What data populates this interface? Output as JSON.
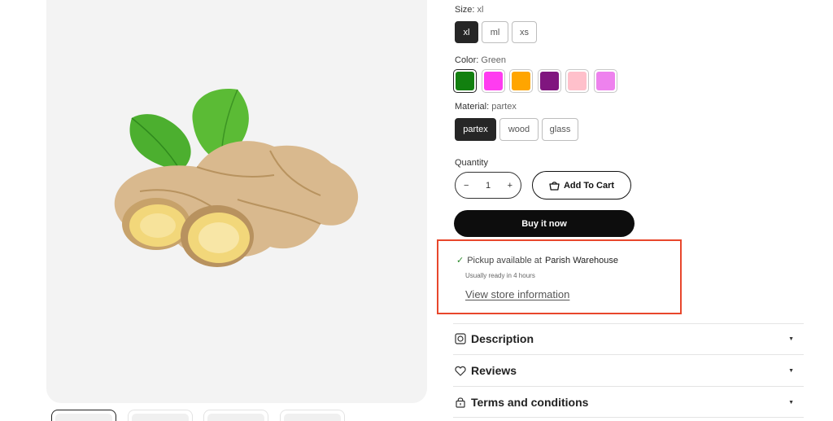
{
  "size": {
    "label": "Size:",
    "value": "xl",
    "options": [
      "xl",
      "ml",
      "xs"
    ],
    "selected": "xl"
  },
  "color": {
    "label": "Color:",
    "value": "Green",
    "selected_index": 0,
    "swatches": [
      "#12800f",
      "#ff3cf0",
      "#ffa500",
      "#80167f",
      "#ffc0cb",
      "#ee82ee"
    ]
  },
  "material": {
    "label": "Material:",
    "value": "partex",
    "options": [
      "partex",
      "wood",
      "glass"
    ],
    "selected": "partex"
  },
  "quantity": {
    "label": "Quantity",
    "minus": "−",
    "value": "1",
    "plus": "+"
  },
  "add_to_cart": {
    "label": "Add To Cart",
    "icon": "bag-icon"
  },
  "buy_now": {
    "label": "Buy it now"
  },
  "pickup": {
    "check": "✓",
    "text": "Pickup available at",
    "location": "Parish Warehouse",
    "subtext": "Usually ready in 4 hours",
    "link": "View store information"
  },
  "accordion": [
    {
      "title": "Description",
      "icon": "description-icon"
    },
    {
      "title": "Reviews",
      "icon": "heart-icon"
    },
    {
      "title": "Terms and conditions",
      "icon": "lock-icon"
    }
  ],
  "caret": "▼",
  "colors": {
    "accent_box": "#e8472c",
    "dark": "#0d0d0d"
  }
}
